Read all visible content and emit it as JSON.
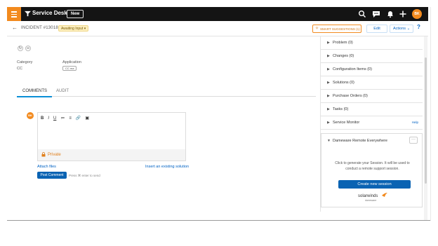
{
  "topbar": {
    "app_title": "Service Desk",
    "new_button": "New",
    "avatar_initials": "BK",
    "icons": [
      "menu-icon",
      "search-icon",
      "chat-icon",
      "notifications-icon",
      "add-icon"
    ],
    "accent": "#f28a1e"
  },
  "header": {
    "incident": "INCIDENT #13018",
    "status": "Awaiting Input",
    "smart_button": "SMART SUGGESTIONS (1)",
    "edit": "Edit",
    "actions": "Actions",
    "help": "?"
  },
  "fields": {
    "category_label": "Category",
    "category_value": "CC",
    "application_label": "Application",
    "application_value": "CC ma"
  },
  "tabs": [
    "COMMENTS",
    "AUDIT"
  ],
  "comment": {
    "avatar_initials": "BK",
    "toolbar": [
      "B",
      "I",
      "U",
      "≔",
      "≡",
      "🔗",
      "▣"
    ],
    "private": "Private",
    "attach": "Attach files",
    "insert_solution": "Insert an existing solution",
    "post": "Post Comment",
    "hint": "Press ⌘ enter to send"
  },
  "right_panel": {
    "items": [
      {
        "label": "Problem (0)",
        "aux": ""
      },
      {
        "label": "Changes (0)",
        "aux": ""
      },
      {
        "label": "Configuration Items (0)",
        "aux": ""
      },
      {
        "label": "Solutions (0)",
        "aux": ""
      },
      {
        "label": "Purchase Orders (0)",
        "aux": ""
      },
      {
        "label": "Tasks (0)",
        "aux": ""
      },
      {
        "label": "Service Monitor",
        "aux": "Help"
      }
    ],
    "dameware": {
      "title": "Dameware Remote Everywhere",
      "more": "···",
      "description": "Click to generate your Session. It will be used to conduct a remote support session.",
      "button": "Create new session",
      "logo_text": "solarwinds",
      "logo_sub": "dameware"
    }
  }
}
